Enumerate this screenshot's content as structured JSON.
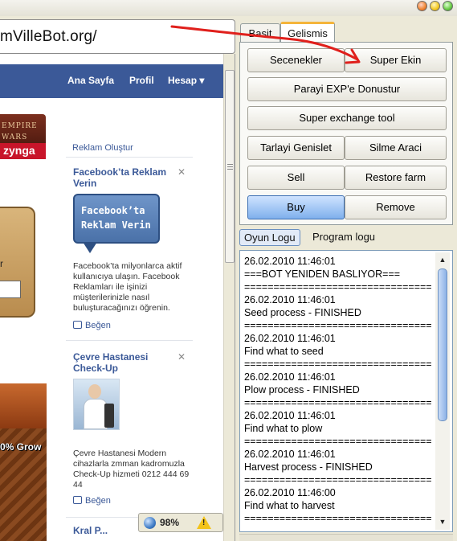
{
  "window": {
    "controls": [
      "close-icon",
      "minimize-icon",
      "maximize-icon"
    ]
  },
  "browser": {
    "address_url": "mVilleBot.org/",
    "nav": [
      "Ana Sayfa",
      "Profil",
      "Hesap ▾"
    ],
    "empire_text": [
      "EMPIRE",
      "WARS"
    ],
    "zynga_label": "zynga",
    "wood_letter": "r",
    "farm_overlay": "0% Grow",
    "ads": {
      "create_link": "Reklam Oluştur",
      "ad1_title": "Facebook’ta Reklam Verin",
      "ad1_image_text": [
        "Facebook’ta",
        "Reklam Verin"
      ],
      "ad1_body": "Facebook’ta milyonlarca aktif kullanıcıya ulaşın. Facebook Reklamları ile işinizi müşterilerinizle nasıl buluşturacağınızı öğrenin.",
      "ad1_like": "Beğen",
      "ad2_title": "Çevre Hastanesi Check-Up",
      "ad2_body": "Çevre Hastanesi Modern cihazlarla zmman kadromuzla Check-Up hizmeti 0212 444 69 44",
      "ad2_like": "Beğen",
      "ad3_title_partial": "Kral P..."
    },
    "status": {
      "zoom": "98%",
      "warning_icon": "warning-icon"
    }
  },
  "bot": {
    "tabs": [
      "Basit",
      "Gelismis"
    ],
    "active_tab": "Gelismis",
    "buttons": {
      "secenekler": "Secenekler",
      "super_ekin": "Super Ekin",
      "parayi_exp": "Parayi EXP'e Donustur",
      "super_exchange": "Super exchange tool",
      "tarlayi_genislet": "Tarlayi Genislet",
      "silme_araci": "Silme Araci",
      "sell": "Sell",
      "restore_farm": "Restore farm",
      "buy": "Buy",
      "remove": "Remove"
    },
    "log_tabs": [
      "Oyun Logu",
      "Program logu"
    ],
    "active_log_tab": "Oyun Logu",
    "log_lines": [
      "26.02.2010 11:46:01",
      "===BOT YENIDEN BASLIYOR===",
      "================================",
      "26.02.2010 11:46:01",
      "Seed process - FINISHED",
      "================================",
      "26.02.2010 11:46:01",
      "Find what to seed",
      "================================",
      "26.02.2010 11:46:01",
      "Plow process - FINISHED",
      "================================",
      "26.02.2010 11:46:01",
      "Find what to plow",
      "================================",
      "26.02.2010 11:46:01",
      "Harvest process - FINISHED",
      "================================",
      "26.02.2010 11:46:00",
      "Find what to harvest",
      "================================"
    ]
  },
  "colors": {
    "facebook_blue": "#3b5998",
    "annotation_red": "#e0201c",
    "active_button": "#7fb0ec",
    "tab_highlight": "#f4b43a"
  }
}
